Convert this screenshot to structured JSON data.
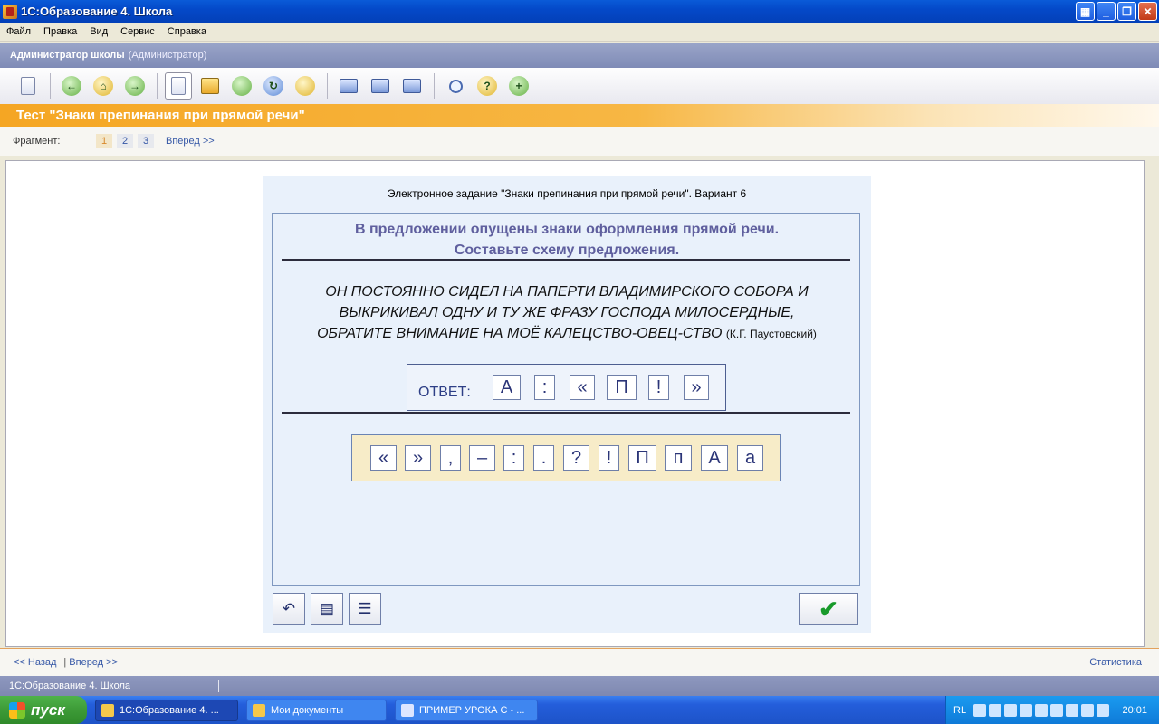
{
  "window": {
    "title": "1С:Образование 4. Школа"
  },
  "menu": [
    "Файл",
    "Правка",
    "Вид",
    "Сервис",
    "Справка"
  ],
  "user": {
    "name": "Администратор школы",
    "role": "(Администратор)"
  },
  "toolbar": {
    "groups": [
      [
        "exit-icon"
      ],
      [
        "back-icon",
        "home-icon",
        "forward-icon"
      ],
      [
        "page-icon",
        "book-icon",
        "export-icon",
        "refresh-icon",
        "profile-icon"
      ],
      [
        "screen-icon",
        "screen-down-icon",
        "print-icon"
      ],
      [
        "search-icon",
        "help-icon",
        "add-icon"
      ]
    ]
  },
  "test": {
    "title": "Тест \"Знаки препинания при прямой речи\""
  },
  "fragments": {
    "label": "Фрагмент:",
    "items": [
      "1",
      "2",
      "3"
    ],
    "current": "1",
    "next": "Вперед >>"
  },
  "task": {
    "title": "Электронное задание \"Знаки препинания при прямой речи\". Вариант 6",
    "instruction_line1": "В предложении опущены знаки оформления прямой речи.",
    "instruction_line2": "Составьте схему предложения.",
    "sentence_line1": "ОН ПОСТОЯННО СИДЕЛ НА ПАПЕРТИ ВЛАДИМИРСКОГО СОБОРА И",
    "sentence_line2": "ВЫКРИКИВАЛ ОДНУ И ТУ ЖЕ ФРАЗУ ГОСПОДА МИЛОСЕРДНЫЕ,",
    "sentence_line3": "ОБРАТИТЕ ВНИМАНИЕ НА МОЁ КАЛЕЦСТВО-ОВЕЦ-СТВО",
    "author": "(К.Г. Паустовский)",
    "answer_label": "ОТВЕТ:",
    "answer": [
      "А",
      ":",
      "«",
      "П",
      "!",
      "»"
    ],
    "choices": [
      "«",
      "»",
      ",",
      "–",
      ":",
      ".",
      "?",
      "!",
      "П",
      "п",
      "А",
      "а"
    ]
  },
  "nav": {
    "back": "<< Назад",
    "separator": "|",
    "forward": "Вперед >>",
    "stats": "Статистика"
  },
  "status": {
    "text": "1С:Образование 4. Школа"
  },
  "taskbar": {
    "start": "пуск",
    "tasks": [
      "1С:Образование 4. ...",
      "Мои документы",
      "ПРИМЕР УРОКА С - ..."
    ],
    "lang": "RL",
    "clock": "20:01"
  }
}
